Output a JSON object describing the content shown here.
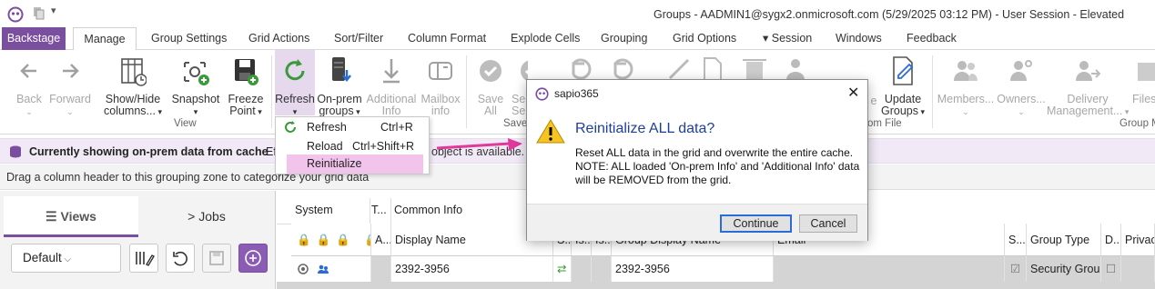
{
  "window": {
    "title": "Groups - AADMIN1@sygx2.onmicrosoft.com (5/29/2025 03:12 PM) - User Session - Elevated"
  },
  "tabs": [
    "Backstage",
    "Manage",
    "Group Settings",
    "Grid Actions",
    "Sort/Filter",
    "Column Format",
    "Explode Cells",
    "Grouping",
    "Grid Options",
    "Session",
    "Windows",
    "Feedback"
  ],
  "ribbon": {
    "back": "Back",
    "forward": "Forward",
    "showhide1": "Show/Hide",
    "showhide2": "columns...",
    "snapshot": "Snapshot",
    "freeze1": "Freeze",
    "freeze2": "Point",
    "view_group": "View",
    "refresh": "Refresh",
    "onprem1": "On-prem",
    "onprem2": "groups",
    "addinfo1": "Additional",
    "addinfo2": "Info",
    "mailbox1": "Mailbox",
    "mailbox2": "info",
    "saveall1": "Save",
    "saveall2": "All",
    "save_partial": "Save",
    "sel_partial1": "Sel",
    "sel_partial2": "Se",
    "e_partial": "e",
    "update1": "Update",
    "update2": "Groups",
    "fromfile": "om File",
    "members": "Members...",
    "owners": "Owners...",
    "delivery1": "Delivery",
    "delivery2": "Management...",
    "files": "Files",
    "groupm": "Group M"
  },
  "refresh_menu": {
    "items": [
      {
        "label": "Refresh",
        "shortcut": "Ctrl+R"
      },
      {
        "label": "Reload",
        "shortcut": "Ctrl+Shift+R"
      },
      {
        "label": "Reinitialize",
        "shortcut": ""
      }
    ]
  },
  "infobar": {
    "message": "Currently showing on-prem data from cache",
    "ef": "Ef",
    "available": "object is available."
  },
  "grouping": {
    "hint": "Drag a column header to this grouping zone to categorize your grid data"
  },
  "panel": {
    "views": "Views",
    "jobs": "Jobs",
    "selected_view": "Default"
  },
  "grid": {
    "top_headers": {
      "system": "System",
      "t": "T...",
      "common": "Common Info"
    },
    "headers": {
      "a": "A...",
      "display_name": "Display Name",
      "s": "S...",
      "is1": "Is...",
      "is2": "Is...",
      "group_display_name": "Group Display Name",
      "email": "Email",
      "s2": "S...",
      "group_type": "Group Type",
      "d": "D...",
      "privacy": "Privac"
    },
    "row": {
      "display_name": "2392-3956",
      "group_display_name": "2392-3956",
      "group_type": "Security Grou"
    }
  },
  "dialog": {
    "app": "sapio365",
    "instruction": "Reinitialize ALL data?",
    "line1": "Reset ALL data in the grid and overwrite the entire cache.",
    "line2": "NOTE: ALL loaded 'On-prem Info' and 'Additional Info' data",
    "line3": "will be REMOVED from the grid.",
    "continue": "Continue",
    "cancel": "Cancel"
  },
  "colors": {
    "accent": "#7b4fa0",
    "highlight": "#f2c4ec",
    "arrow": "#e0399c",
    "link": "#1e3f9a"
  }
}
